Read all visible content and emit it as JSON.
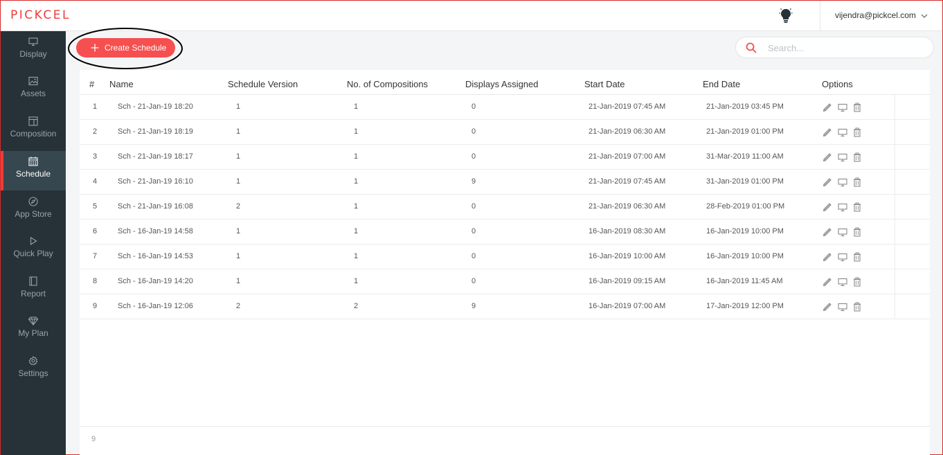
{
  "header": {
    "logo_text": "PICKCEL",
    "user_email": "vijendra@pickcel.com"
  },
  "sidebar": {
    "items": [
      {
        "label": "Display",
        "icon": "monitor-icon"
      },
      {
        "label": "Assets",
        "icon": "image-icon"
      },
      {
        "label": "Composition",
        "icon": "layout-icon"
      },
      {
        "label": "Schedule",
        "icon": "calendar-icon",
        "active": true
      },
      {
        "label": "App Store",
        "icon": "compass-icon"
      },
      {
        "label": "Quick Play",
        "icon": "play-icon"
      },
      {
        "label": "Report",
        "icon": "book-icon"
      },
      {
        "label": "My Plan",
        "icon": "diamond-icon"
      },
      {
        "label": "Settings",
        "icon": "gear-icon"
      }
    ]
  },
  "toolbar": {
    "create_label": "Create Schedule",
    "search_placeholder": "Search...",
    "search_value": ""
  },
  "table": {
    "columns": [
      "#",
      "Name",
      "Schedule Version",
      "No. of Compositions",
      "Displays Assigned",
      "Start Date",
      "End Date",
      "Options"
    ],
    "rows": [
      {
        "num": "1",
        "name": "Sch - 21-Jan-19 18:20",
        "version": "1",
        "compositions": "1",
        "displays": "0",
        "start": "21-Jan-2019 07:45 AM",
        "end": "21-Jan-2019 03:45 PM"
      },
      {
        "num": "2",
        "name": "Sch - 21-Jan-19 18:19",
        "version": "1",
        "compositions": "1",
        "displays": "0",
        "start": "21-Jan-2019 06:30 AM",
        "end": "21-Jan-2019 01:00 PM"
      },
      {
        "num": "3",
        "name": "Sch - 21-Jan-19 18:17",
        "version": "1",
        "compositions": "1",
        "displays": "0",
        "start": "21-Jan-2019 07:00 AM",
        "end": "31-Mar-2019 11:00 AM"
      },
      {
        "num": "4",
        "name": "Sch - 21-Jan-19 16:10",
        "version": "1",
        "compositions": "1",
        "displays": "9",
        "start": "21-Jan-2019 07:45 AM",
        "end": "31-Jan-2019 01:00 PM"
      },
      {
        "num": "5",
        "name": "Sch - 21-Jan-19 16:08",
        "version": "2",
        "compositions": "1",
        "displays": "0",
        "start": "21-Jan-2019 06:30 AM",
        "end": "28-Feb-2019 01:00 PM"
      },
      {
        "num": "6",
        "name": "Sch - 16-Jan-19 14:58",
        "version": "1",
        "compositions": "1",
        "displays": "0",
        "start": "16-Jan-2019 08:30 AM",
        "end": "16-Jan-2019 10:00 PM"
      },
      {
        "num": "7",
        "name": "Sch - 16-Jan-19 14:53",
        "version": "1",
        "compositions": "1",
        "displays": "0",
        "start": "16-Jan-2019 10:00 AM",
        "end": "16-Jan-2019 10:00 PM"
      },
      {
        "num": "8",
        "name": "Sch - 16-Jan-19 14:20",
        "version": "1",
        "compositions": "1",
        "displays": "0",
        "start": "16-Jan-2019 09:15 AM",
        "end": "16-Jan-2019 11:45 AM"
      },
      {
        "num": "9",
        "name": "Sch - 16-Jan-19 12:06",
        "version": "2",
        "compositions": "2",
        "displays": "9",
        "start": "16-Jan-2019 07:00 AM",
        "end": "17-Jan-2019 12:00 PM"
      }
    ],
    "row_options": [
      "pencil-icon",
      "monitor-icon",
      "trash-icon"
    ],
    "footer_count": "9"
  },
  "colors": {
    "accent": "#f64f4f",
    "sidebar_bg": "#263238",
    "sidebar_active_bg": "#37474f"
  }
}
